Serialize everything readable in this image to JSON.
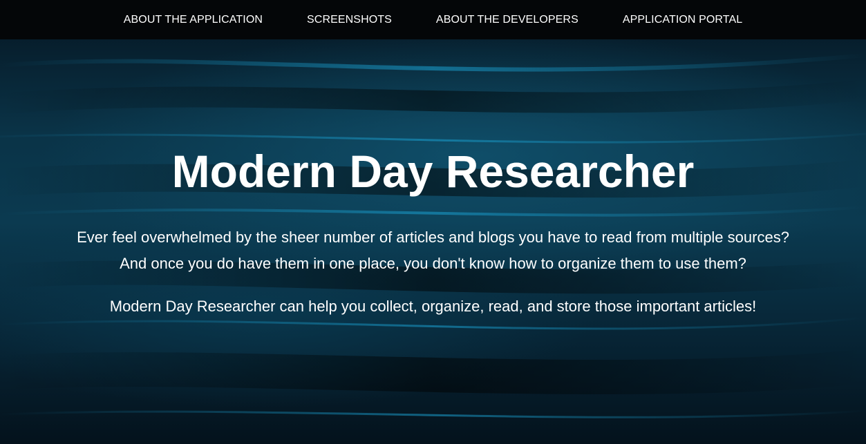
{
  "nav": {
    "items": [
      {
        "label": "ABOUT THE APPLICATION"
      },
      {
        "label": "SCREENSHOTS"
      },
      {
        "label": "ABOUT THE DEVELOPERS"
      },
      {
        "label": "APPLICATION PORTAL"
      }
    ]
  },
  "hero": {
    "title": "Modern Day Researcher",
    "intro_line1": "Ever feel overwhelmed by the sheer number of articles and blogs you have to read from multiple sources?",
    "intro_line2": "And once you do have them in one place, you don't know how to organize them to use them?",
    "tagline": "Modern Day Researcher can help you collect, organize, read, and store those important articles!"
  },
  "colors": {
    "navbar_bg": "#040608",
    "text": "#ffffff",
    "background_accent": "#0b3a50"
  }
}
